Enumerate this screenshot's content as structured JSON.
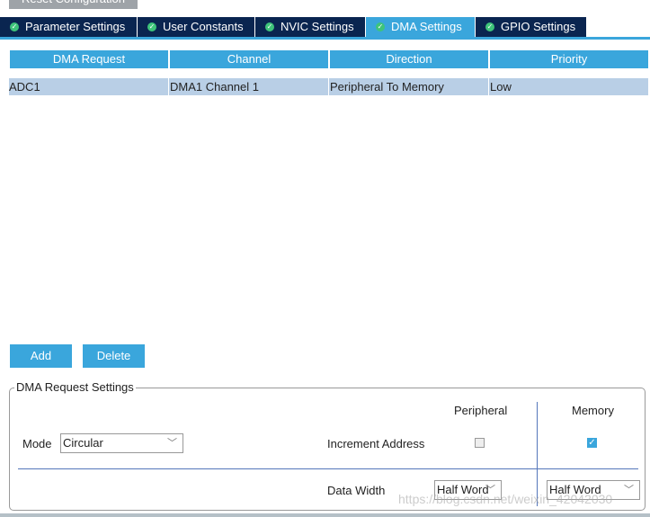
{
  "top_button": "Reset Configuration",
  "tabs": [
    {
      "label": "Parameter Settings"
    },
    {
      "label": "User Constants"
    },
    {
      "label": "NVIC Settings"
    },
    {
      "label": "DMA Settings",
      "active": true
    },
    {
      "label": "GPIO Settings"
    }
  ],
  "table": {
    "headers": [
      "DMA Request",
      "Channel",
      "Direction",
      "Priority"
    ],
    "rows": [
      [
        "ADC1",
        "DMA1 Channel 1",
        "Peripheral To Memory",
        "Low"
      ]
    ]
  },
  "buttons": {
    "add": "Add",
    "delete": "Delete"
  },
  "settings": {
    "title": "DMA Request Settings",
    "peripheral": "Peripheral",
    "memory": "Memory",
    "mode_label": "Mode",
    "mode_value": "Circular",
    "increment_label": "Increment Address",
    "peripheral_increment": false,
    "memory_increment": true,
    "data_width_label": "Data Width",
    "peripheral_width": "Half Word",
    "memory_width": "Half Word"
  },
  "watermark": "https://blog.csdn.net/weixin_42042030",
  "colors": {
    "accent": "#3aa6dc",
    "tab_dark": "#0a2550",
    "row_selected": "#b9cfe6"
  }
}
